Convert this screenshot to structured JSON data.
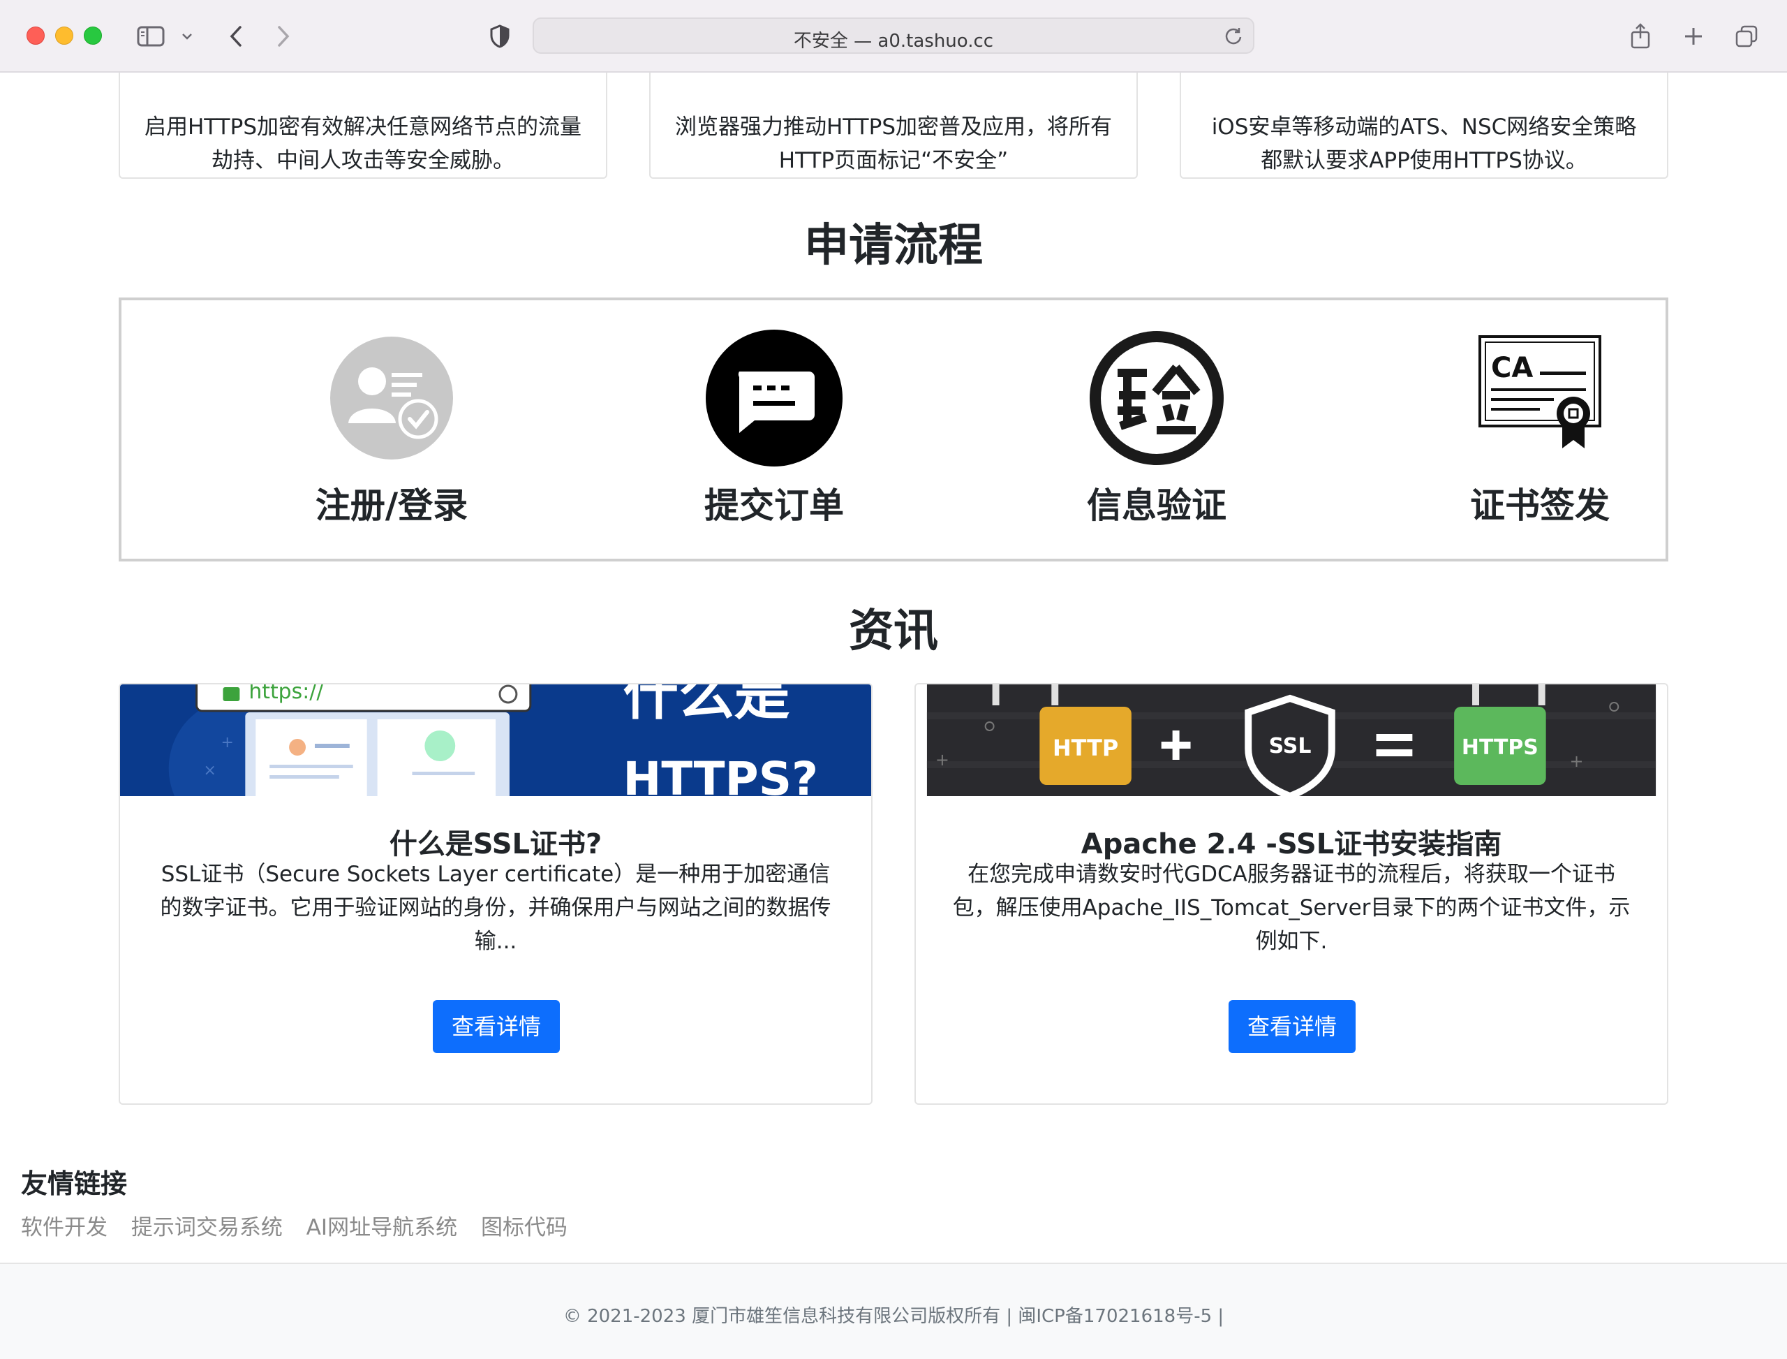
{
  "browser": {
    "url": "不安全 — a0.tashuo.cc"
  },
  "features": [
    {
      "text": "启用HTTPS加密有效解决任意网络节点的流量劫持、中间人攻击等安全威胁。"
    },
    {
      "text": "浏览器强力推动HTTPS加密普及应用，将所有HTTP页面标记“不安全”"
    },
    {
      "text": "iOS安卓等移动端的ATS、NSC网络安全策略都默认要求APP使用HTTPS协议。"
    }
  ],
  "process": {
    "title": "申请流程",
    "steps": [
      {
        "label": "注册/登录",
        "icon": "user-verified-icon"
      },
      {
        "label": "提交订单",
        "icon": "message-icon"
      },
      {
        "label": "信息验证",
        "icon": "verify-seal-icon"
      },
      {
        "label": "证书签发",
        "icon": "ca-certificate-icon"
      }
    ]
  },
  "news": {
    "title": "资讯",
    "items": [
      {
        "image_url_text": "https://",
        "image_heading_1": "什么是",
        "image_heading_2": "HTTPS?",
        "title": "什么是SSL证书?",
        "desc": "SSL证书（Secure Sockets Layer certificate）是一种用于加密通信的数字证书。它用于验证网站的身份，并确保用户与网站之间的数据传输...",
        "button": "查看详情"
      },
      {
        "image_http": "HTTP",
        "image_ssl": "SSL",
        "image_https": "HTTPS",
        "title": "Apache 2.4 -SSL证书安装指南",
        "desc": "在您完成申请数安时代GDCA服务器证书的流程后，将获取一个证书包，解压使用Apache_IIS_Tomcat_Server目录下的两个证书文件，示例如下.",
        "button": "查看详情"
      }
    ]
  },
  "friend_links": {
    "title": "友情链接",
    "items": [
      "软件开发",
      "提示词交易系统",
      "AI网址导航系统",
      "图标代码"
    ]
  },
  "footer": {
    "text": "© 2021-2023 厦门市雄笙信息科技有限公司版权所有  |  闽ICP备17021618号-5  |"
  },
  "colors": {
    "primary_button": "#0d6efd",
    "news_banner_blue": "#0a3a8c",
    "news_banner_dark": "#2a2a2e",
    "http_badge": "#e5a92b",
    "https_badge": "#5cb85c"
  }
}
